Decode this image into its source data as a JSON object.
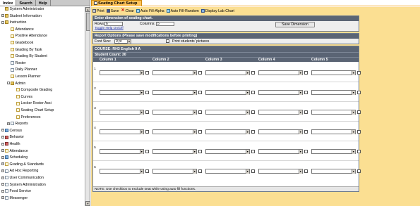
{
  "nav": {
    "tabs": [
      "Index",
      "Search",
      "Help"
    ],
    "tree": [
      {
        "label": "System Administrator",
        "icon": "folder-icon",
        "cls": "folder",
        "level": 0,
        "exp": ""
      },
      {
        "label": "Student Information",
        "icon": "folder-icon",
        "cls": "folder",
        "level": 0,
        "exp": "+"
      },
      {
        "label": "Instruction",
        "icon": "folder-icon",
        "cls": "folder",
        "level": 0,
        "exp": "-"
      },
      {
        "label": "Attendance",
        "icon": "page-icon",
        "cls": "page",
        "level": 1,
        "exp": ""
      },
      {
        "label": "Positive Attendance",
        "icon": "page-icon",
        "cls": "page",
        "level": 1,
        "exp": ""
      },
      {
        "label": "Gradebook",
        "icon": "page-icon",
        "cls": "page",
        "level": 1,
        "exp": ""
      },
      {
        "label": "Grading By Task",
        "icon": "page-icon",
        "cls": "page",
        "level": 1,
        "exp": ""
      },
      {
        "label": "Grading By Student",
        "icon": "page-icon",
        "cls": "page",
        "level": 1,
        "exp": ""
      },
      {
        "label": "Roster",
        "icon": "doc-icon",
        "cls": "doc",
        "level": 1,
        "exp": ""
      },
      {
        "label": "Daily Planner",
        "icon": "doc-icon",
        "cls": "doc",
        "level": 1,
        "exp": ""
      },
      {
        "label": "Lesson Planner",
        "icon": "page-icon",
        "cls": "page",
        "level": 1,
        "exp": ""
      },
      {
        "label": "Admin",
        "icon": "folder-icon",
        "cls": "folder",
        "level": 1,
        "exp": "-"
      },
      {
        "label": "Composite Grading",
        "icon": "page-icon",
        "cls": "page",
        "level": 2,
        "exp": ""
      },
      {
        "label": "Curves",
        "icon": "page-icon",
        "cls": "page",
        "level": 2,
        "exp": ""
      },
      {
        "label": "Locker Roster Assi",
        "icon": "page-icon",
        "cls": "page",
        "level": 2,
        "exp": ""
      },
      {
        "label": "Seating Chart Setup",
        "icon": "page-icon",
        "cls": "page",
        "level": 2,
        "exp": ""
      },
      {
        "label": "Preferences",
        "icon": "page-icon",
        "cls": "page",
        "level": 2,
        "exp": ""
      },
      {
        "label": "Reports",
        "icon": "doc-icon",
        "cls": "doc",
        "level": 1,
        "exp": "+"
      },
      {
        "label": "Census",
        "icon": "chart-icon",
        "cls": "chart",
        "level": 0,
        "exp": "+"
      },
      {
        "label": "Behavior",
        "icon": "book-icon",
        "cls": "book",
        "level": 0,
        "exp": "+"
      },
      {
        "label": "Health",
        "icon": "book-icon",
        "cls": "book",
        "level": 0,
        "exp": "+"
      },
      {
        "label": "Attendance",
        "icon": "page-icon",
        "cls": "page",
        "level": 0,
        "exp": "+"
      },
      {
        "label": "Scheduling",
        "icon": "chart-icon",
        "cls": "chart",
        "level": 0,
        "exp": "+"
      },
      {
        "label": "Grading & Standards",
        "icon": "page-icon",
        "cls": "page",
        "level": 0,
        "exp": "+"
      },
      {
        "label": "Ad Hoc Reporting",
        "icon": "doc-icon",
        "cls": "doc",
        "level": 0,
        "exp": "+"
      },
      {
        "label": "User Communication",
        "icon": "doc-icon",
        "cls": "doc",
        "level": 0,
        "exp": "+"
      },
      {
        "label": "System Administration",
        "icon": "doc-icon",
        "cls": "doc",
        "level": 0,
        "exp": "+"
      },
      {
        "label": "Food Service",
        "icon": "doc-icon",
        "cls": "doc",
        "level": 0,
        "exp": "+"
      },
      {
        "label": "Messenger",
        "icon": "doc-icon",
        "cls": "doc",
        "level": 0,
        "exp": "+"
      }
    ]
  },
  "window_tab": "Seating Chart Setup",
  "toolbar": {
    "print": "Print",
    "save": "Save",
    "clear": "Clear",
    "auto_alpha": "Auto Fill-Alpha",
    "auto_random": "Auto Fill-Random",
    "lab_chart": "Display Lab Chart"
  },
  "dimension": {
    "header": "Enter dimension of seating chart.",
    "rows_label": "Rows:",
    "rows_value": "6",
    "columns_label": "Columns:",
    "columns_value": "5",
    "save_button": "Save Dimension",
    "help_link": "Toggle Help On/Off"
  },
  "report_options": {
    "header": "Report Options (Please save modifications before printing)",
    "font_size_label": "Font Size:",
    "font_size_value": "9 pt",
    "print_pictures_label": "Print students' pictures"
  },
  "grid": {
    "course": "COURSE: RH3 English 9 A",
    "student_count": "Student Count: 30",
    "columns": [
      "Column 1",
      "Column 2",
      "Column 3",
      "Column 4",
      "Column 5"
    ],
    "rows": [
      "1",
      "2",
      "3",
      "4",
      "5",
      "6"
    ],
    "note": "NOTE: Use checkbox to exclude seat while using auto fill functions."
  }
}
